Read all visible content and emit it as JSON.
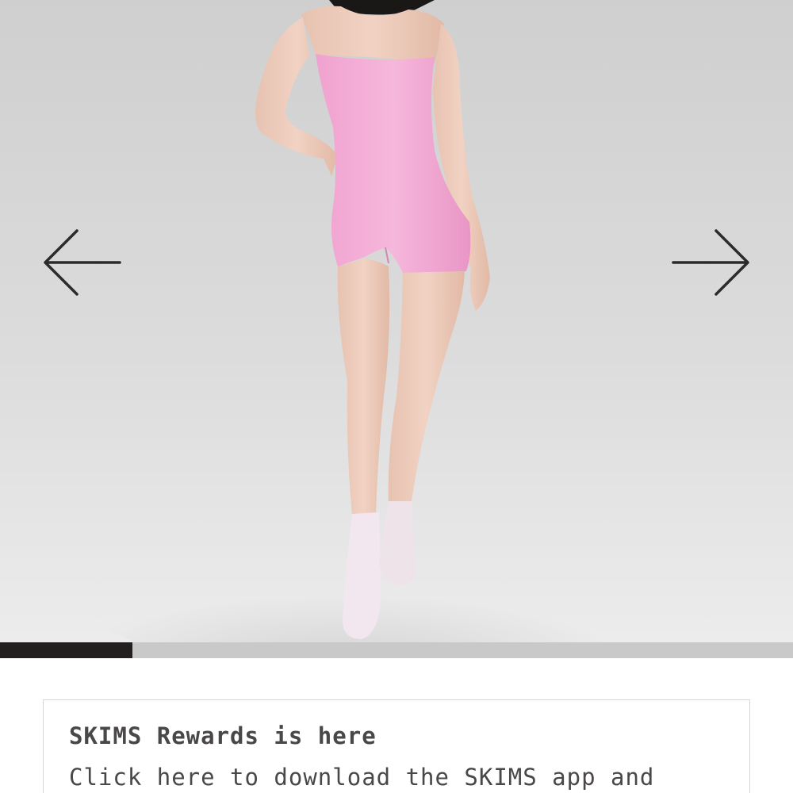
{
  "carousel": {
    "prev_icon": "arrow-left-icon",
    "next_icon": "arrow-right-icon",
    "progress": 0.167,
    "colors": {
      "backdrop": "#d8d8d8",
      "garment": "#f2a9d4",
      "progress_fill": "#231f1e",
      "progress_track": "#c9c9c9"
    }
  },
  "rewards": {
    "title": "SKIMS Rewards is here",
    "body": "Click here to download the SKIMS app and"
  }
}
